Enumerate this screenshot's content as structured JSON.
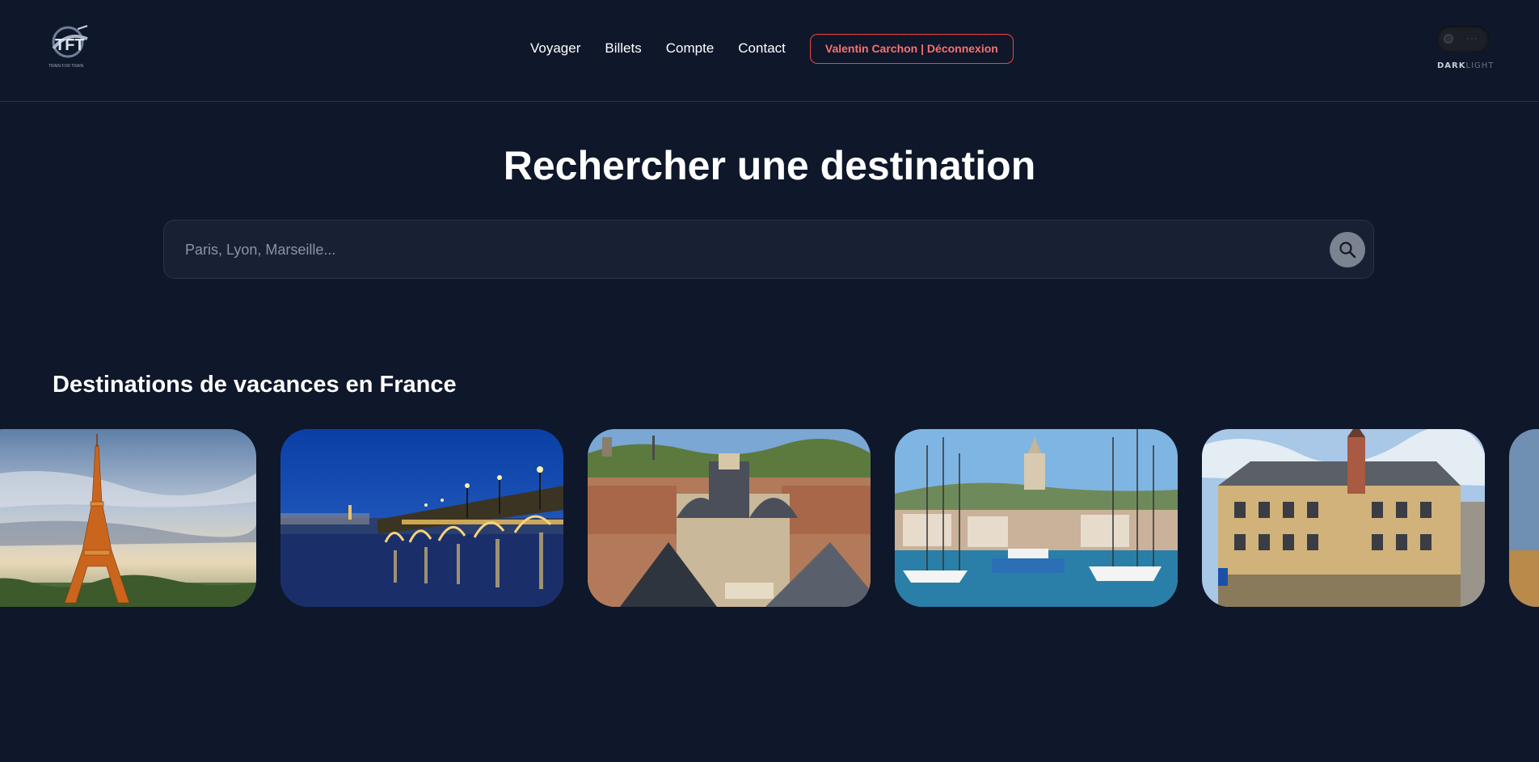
{
  "header": {
    "logo_text": "TRAIN FOR TRAIN",
    "nav": [
      {
        "label": "Voyager"
      },
      {
        "label": "Billets"
      },
      {
        "label": "Compte"
      },
      {
        "label": "Contact"
      }
    ],
    "user_button": "Valentin Carchon | Déconnexion",
    "theme": {
      "dark_label": "DARK",
      "light_label": "LIGHT",
      "active": "dark"
    }
  },
  "hero": {
    "title": "Rechercher une destination",
    "search_placeholder": "Paris, Lyon, Marseille...",
    "search_value": ""
  },
  "destinations": {
    "title": "Destinations de vacances en France",
    "cards": [
      {
        "image": "eiffel-tower-paris"
      },
      {
        "image": "pont-de-pierre-bordeaux"
      },
      {
        "image": "lyon-rooftops"
      },
      {
        "image": "vieux-port-marseille"
      },
      {
        "image": "vieille-bourse-lille"
      },
      {
        "image": "partial-card"
      }
    ]
  },
  "colors": {
    "background": "#0f172a",
    "accent_red": "#ef4444",
    "search_bg": "#182134"
  }
}
